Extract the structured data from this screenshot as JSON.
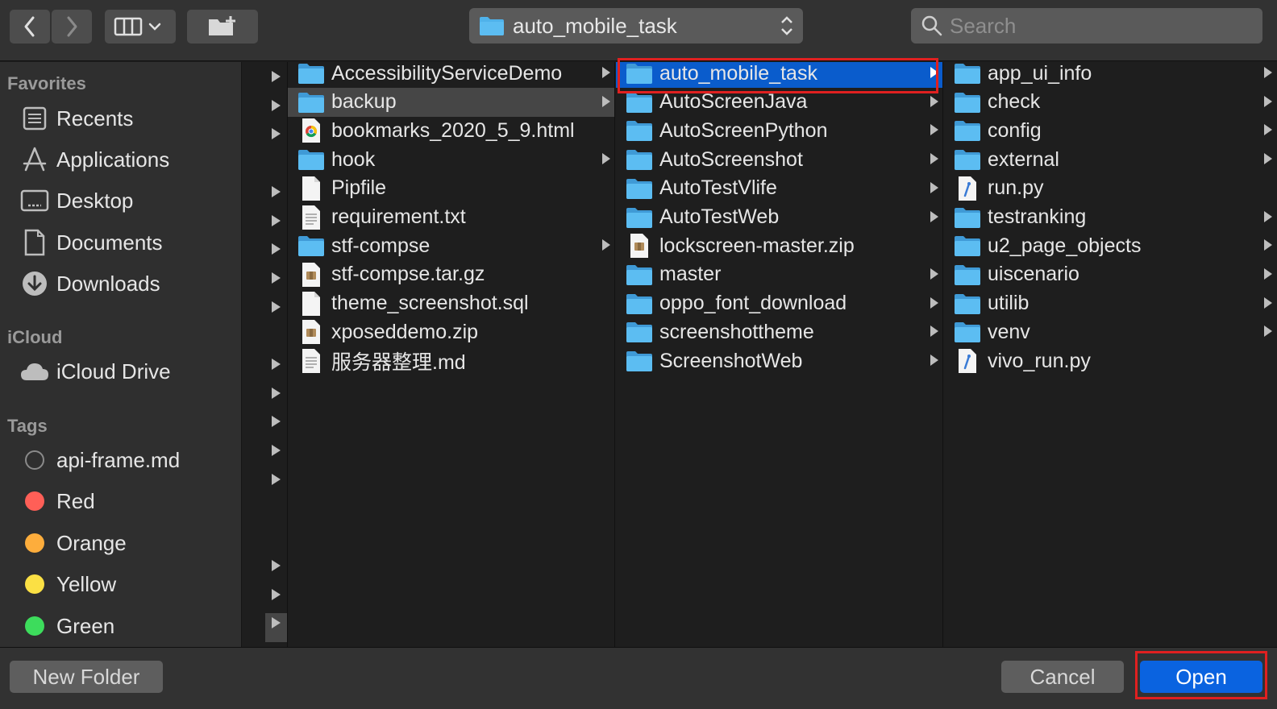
{
  "toolbar": {
    "back_icon": "chevron-left-icon",
    "forward_icon": "chevron-right-icon",
    "view_icon": "column-view-icon",
    "new_folder_icon": "new-folder-icon",
    "path_selector": "auto_mobile_task",
    "search_placeholder": "Search"
  },
  "sidebar": {
    "favorites_title": "Favorites",
    "favorites": [
      {
        "label": "Recents",
        "icon": "recents-icon"
      },
      {
        "label": "Applications",
        "icon": "applications-icon"
      },
      {
        "label": "Desktop",
        "icon": "desktop-icon"
      },
      {
        "label": "Documents",
        "icon": "documents-icon"
      },
      {
        "label": "Downloads",
        "icon": "downloads-icon"
      }
    ],
    "icloud_title": "iCloud",
    "icloud": [
      {
        "label": "iCloud Drive",
        "icon": "cloud-icon"
      }
    ],
    "tags_title": "Tags",
    "tags": [
      {
        "label": "api-frame.md",
        "color": "#ffffff00"
      },
      {
        "label": "Red",
        "color": "#ff5f57"
      },
      {
        "label": "Orange",
        "color": "#fdad3c"
      },
      {
        "label": "Yellow",
        "color": "#fbe044"
      },
      {
        "label": "Green",
        "color": "#3ddc5c"
      }
    ]
  },
  "column1": [
    {
      "name": "AccessibilityServiceDemo",
      "type": "folder",
      "arrow": true
    },
    {
      "name": "backup",
      "type": "folder",
      "arrow": true
    },
    {
      "name": "bookmarks_2020_5_9.html",
      "type": "html",
      "arrow": false
    },
    {
      "name": "hook",
      "type": "folder",
      "arrow": true
    },
    {
      "name": "Pipfile",
      "type": "file",
      "arrow": false
    },
    {
      "name": "requirement.txt",
      "type": "text",
      "arrow": false
    },
    {
      "name": "stf-compse",
      "type": "folder",
      "arrow": true
    },
    {
      "name": "stf-compse.tar.gz",
      "type": "archive",
      "arrow": false
    },
    {
      "name": "theme_screenshot.sql",
      "type": "file",
      "arrow": false
    },
    {
      "name": "xposeddemo.zip",
      "type": "archive",
      "arrow": false
    },
    {
      "name": "服务器整理.md",
      "type": "text",
      "arrow": false
    }
  ],
  "column2": [
    {
      "name": "auto_mobile_task",
      "type": "folder",
      "arrow": true
    },
    {
      "name": "AutoScreenJava",
      "type": "folder",
      "arrow": true
    },
    {
      "name": "AutoScreenPython",
      "type": "folder",
      "arrow": true
    },
    {
      "name": "AutoScreenshot",
      "type": "folder",
      "arrow": true
    },
    {
      "name": "AutoTestVlife",
      "type": "folder",
      "arrow": true
    },
    {
      "name": "AutoTestWeb",
      "type": "folder",
      "arrow": true
    },
    {
      "name": "lockscreen-master.zip",
      "type": "archive",
      "arrow": false
    },
    {
      "name": "master",
      "type": "folder",
      "arrow": true
    },
    {
      "name": "oppo_font_download",
      "type": "folder",
      "arrow": true
    },
    {
      "name": "screenshottheme",
      "type": "folder",
      "arrow": true
    },
    {
      "name": "ScreenshotWeb",
      "type": "folder",
      "arrow": true
    }
  ],
  "column3": [
    {
      "name": "app_ui_info",
      "type": "folder",
      "arrow": true
    },
    {
      "name": "check",
      "type": "folder",
      "arrow": true
    },
    {
      "name": "config",
      "type": "folder",
      "arrow": true
    },
    {
      "name": "external",
      "type": "folder",
      "arrow": true
    },
    {
      "name": "run.py",
      "type": "python",
      "arrow": false
    },
    {
      "name": "testranking",
      "type": "folder",
      "arrow": true
    },
    {
      "name": "u2_page_objects",
      "type": "folder",
      "arrow": true
    },
    {
      "name": "uiscenario",
      "type": "folder",
      "arrow": true
    },
    {
      "name": "utilib",
      "type": "folder",
      "arrow": true
    },
    {
      "name": "venv",
      "type": "folder",
      "arrow": true
    },
    {
      "name": "vivo_run.py",
      "type": "python",
      "arrow": false
    }
  ],
  "buttons": {
    "new_folder": "New Folder",
    "cancel": "Cancel",
    "open": "Open"
  },
  "colors": {
    "selection": "#0a5ccc",
    "folder": "#4fb2ea",
    "highlight_box": "#e02020",
    "open_button": "#0a63e0"
  }
}
